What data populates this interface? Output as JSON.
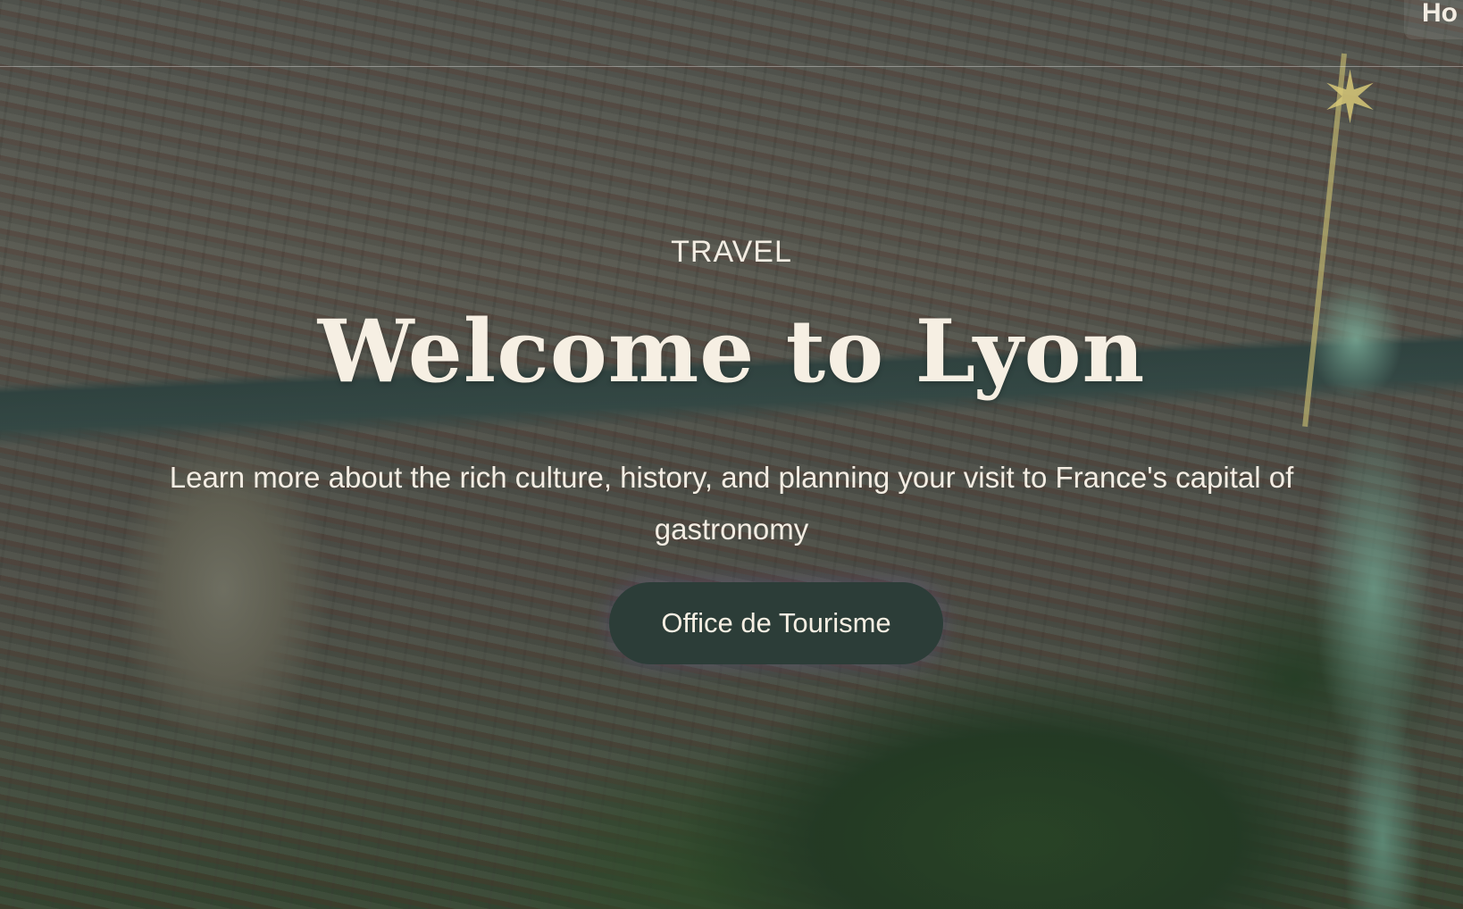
{
  "nav": {
    "partial_link_label": "Ho"
  },
  "hero": {
    "eyebrow": "TRAVEL",
    "title": "Welcome to Lyon",
    "subtitle": "Learn more about the rich culture, history, and planning your visit to France's capital of gastronomy",
    "cta_label": "Office de Tourisme"
  },
  "colors": {
    "button_bg": "#2c3d38",
    "text": "#f6efe3",
    "overlay": "#162220"
  },
  "icons": {
    "statue_star": "star-icon"
  }
}
